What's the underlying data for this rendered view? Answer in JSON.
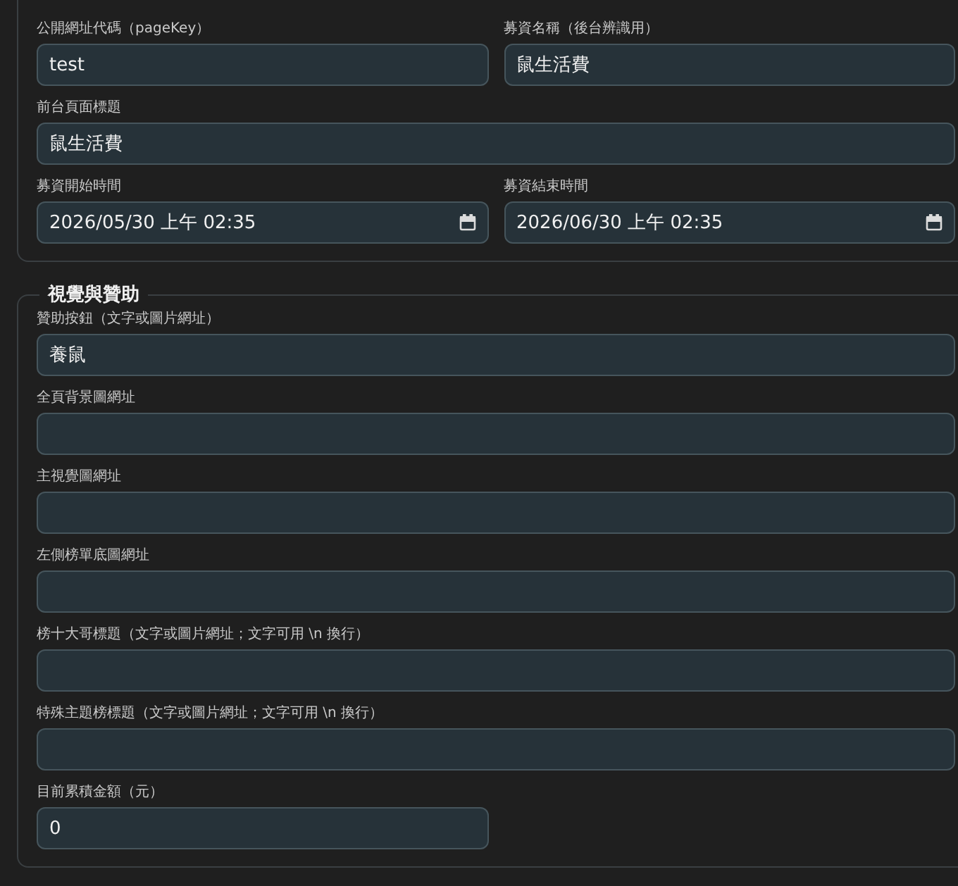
{
  "sections": [
    {
      "rows": [
        [
          {
            "kind": "text",
            "label": "公開網址代碼（pageKey）",
            "value": "test"
          },
          {
            "kind": "text",
            "label": "募資名稱（後台辨識用）",
            "value": "鼠生活費"
          }
        ],
        [
          {
            "kind": "text",
            "label": "前台頁面標題",
            "value": "鼠生活費"
          }
        ],
        [
          {
            "kind": "datetime",
            "label": "募資開始時間",
            "value": "2026/05/30 上午 02:35"
          },
          {
            "kind": "datetime",
            "label": "募資結束時間",
            "value": "2026/06/30 上午 02:35"
          }
        ]
      ]
    },
    {
      "legend": "視覺與贊助",
      "rows": [
        [
          {
            "kind": "text",
            "label": "贊助按鈕（文字或圖片網址）",
            "value": "養鼠"
          }
        ],
        [
          {
            "kind": "text",
            "label": "全頁背景圖網址"
          }
        ],
        [
          {
            "kind": "text",
            "label": "主視覺圖網址"
          }
        ],
        [
          {
            "kind": "text",
            "label": "左側榜單底圖網址"
          }
        ],
        [
          {
            "kind": "text",
            "label": "榜十大哥標題（文字或圖片網址；文字可用 \\n 換行）"
          }
        ],
        [
          {
            "kind": "text",
            "label": "特殊主題榜標題（文字或圖片網址；文字可用 \\n 換行）"
          }
        ],
        [
          {
            "kind": "number",
            "label": "目前累積金額（元）",
            "value": "0"
          }
        ]
      ]
    }
  ]
}
